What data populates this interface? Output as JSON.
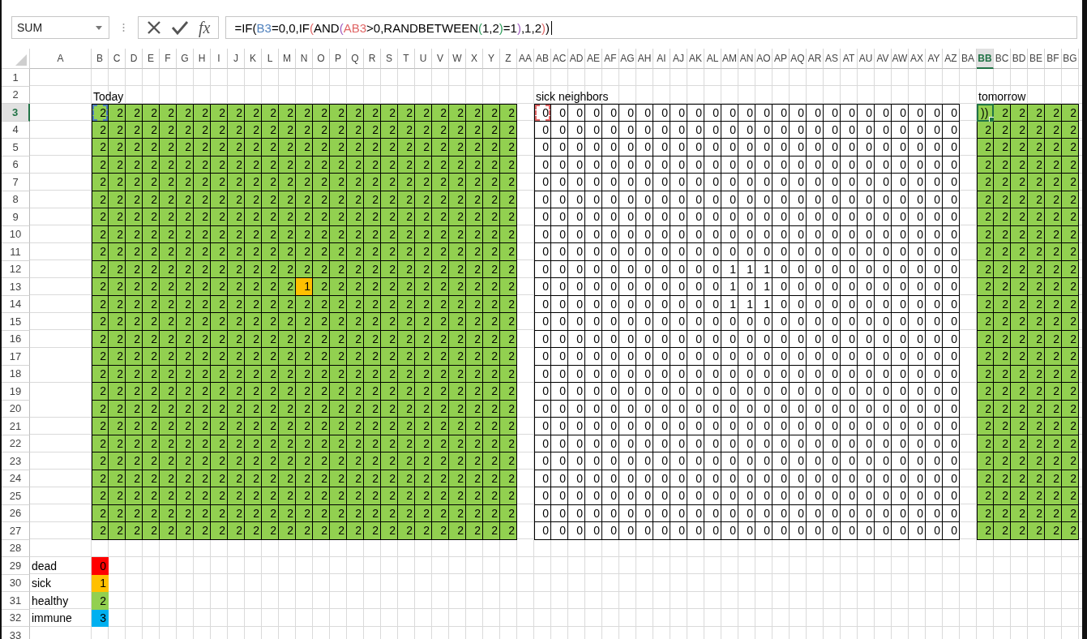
{
  "name_box": {
    "value": "SUM"
  },
  "insert_function": "fx",
  "formula": [
    {
      "text": "=IF(",
      "color": "#000000"
    },
    {
      "text": "B3",
      "color": "#4f81bd"
    },
    {
      "text": "=0,0,IF",
      "color": "#000000"
    },
    {
      "text": "(",
      "color": "#e06666"
    },
    {
      "text": "AND",
      "color": "#000000"
    },
    {
      "text": "(",
      "color": "#a05cc0"
    },
    {
      "text": "AB3",
      "color": "#e06666"
    },
    {
      "text": ">0,RANDBETWEEN",
      "color": "#000000"
    },
    {
      "text": "(",
      "color": "#2e9d5a"
    },
    {
      "text": "1,2",
      "color": "#000000"
    },
    {
      "text": ")",
      "color": "#2e9d5a"
    },
    {
      "text": "=1",
      "color": "#000000"
    },
    {
      "text": ")",
      "color": "#a05cc0"
    },
    {
      "text": ",1,2",
      "color": "#000000"
    },
    {
      "text": ")",
      "color": "#e06666"
    },
    {
      "text": ")",
      "color": "#000000"
    }
  ],
  "sheet": {
    "columns": [
      {
        "label": "A",
        "selected": false
      },
      {
        "label": "B",
        "selected": false
      },
      {
        "label": "C",
        "selected": false
      },
      {
        "label": "D",
        "selected": false
      },
      {
        "label": "E",
        "selected": false
      },
      {
        "label": "F",
        "selected": false
      },
      {
        "label": "G",
        "selected": false
      },
      {
        "label": "H",
        "selected": false
      },
      {
        "label": "I",
        "selected": false
      },
      {
        "label": "J",
        "selected": false
      },
      {
        "label": "K",
        "selected": false
      },
      {
        "label": "L",
        "selected": false
      },
      {
        "label": "M",
        "selected": false
      },
      {
        "label": "N",
        "selected": false
      },
      {
        "label": "O",
        "selected": false
      },
      {
        "label": "P",
        "selected": false
      },
      {
        "label": "Q",
        "selected": false
      },
      {
        "label": "R",
        "selected": false
      },
      {
        "label": "S",
        "selected": false
      },
      {
        "label": "T",
        "selected": false
      },
      {
        "label": "U",
        "selected": false
      },
      {
        "label": "V",
        "selected": false
      },
      {
        "label": "W",
        "selected": false
      },
      {
        "label": "X",
        "selected": false
      },
      {
        "label": "Y",
        "selected": false
      },
      {
        "label": "Z",
        "selected": false
      },
      {
        "label": "AA",
        "selected": false
      },
      {
        "label": "AB",
        "selected": false
      },
      {
        "label": "AC",
        "selected": false
      },
      {
        "label": "AD",
        "selected": false
      },
      {
        "label": "AE",
        "selected": false
      },
      {
        "label": "AF",
        "selected": false
      },
      {
        "label": "AG",
        "selected": false
      },
      {
        "label": "AH",
        "selected": false
      },
      {
        "label": "AI",
        "selected": false
      },
      {
        "label": "AJ",
        "selected": false
      },
      {
        "label": "AK",
        "selected": false
      },
      {
        "label": "AL",
        "selected": false
      },
      {
        "label": "AM",
        "selected": false
      },
      {
        "label": "AN",
        "selected": false
      },
      {
        "label": "AO",
        "selected": false
      },
      {
        "label": "AP",
        "selected": false
      },
      {
        "label": "AQ",
        "selected": false
      },
      {
        "label": "AR",
        "selected": false
      },
      {
        "label": "AS",
        "selected": false
      },
      {
        "label": "AT",
        "selected": false
      },
      {
        "label": "AU",
        "selected": false
      },
      {
        "label": "AV",
        "selected": false
      },
      {
        "label": "AW",
        "selected": false
      },
      {
        "label": "AX",
        "selected": false
      },
      {
        "label": "AY",
        "selected": false
      },
      {
        "label": "AZ",
        "selected": false
      },
      {
        "label": "BA",
        "selected": false
      },
      {
        "label": "BB",
        "selected": true
      },
      {
        "label": "BC",
        "selected": false
      },
      {
        "label": "BD",
        "selected": false
      },
      {
        "label": "BE",
        "selected": false
      },
      {
        "label": "BF",
        "selected": false
      },
      {
        "label": "BG",
        "selected": false
      }
    ],
    "rows": [
      {
        "label": "1",
        "selected": false
      },
      {
        "label": "2",
        "selected": false
      },
      {
        "label": "3",
        "selected": true
      },
      {
        "label": "4",
        "selected": false
      },
      {
        "label": "5",
        "selected": false
      },
      {
        "label": "6",
        "selected": false
      },
      {
        "label": "7",
        "selected": false
      },
      {
        "label": "8",
        "selected": false
      },
      {
        "label": "9",
        "selected": false
      },
      {
        "label": "10",
        "selected": false
      },
      {
        "label": "11",
        "selected": false
      },
      {
        "label": "12",
        "selected": false
      },
      {
        "label": "13",
        "selected": false
      },
      {
        "label": "14",
        "selected": false
      },
      {
        "label": "15",
        "selected": false
      },
      {
        "label": "16",
        "selected": false
      },
      {
        "label": "17",
        "selected": false
      },
      {
        "label": "18",
        "selected": false
      },
      {
        "label": "19",
        "selected": false
      },
      {
        "label": "20",
        "selected": false
      },
      {
        "label": "21",
        "selected": false
      },
      {
        "label": "22",
        "selected": false
      },
      {
        "label": "23",
        "selected": false
      },
      {
        "label": "24",
        "selected": false
      },
      {
        "label": "25",
        "selected": false
      },
      {
        "label": "26",
        "selected": false
      },
      {
        "label": "27",
        "selected": false
      },
      {
        "label": "28",
        "selected": false
      },
      {
        "label": "29",
        "selected": false
      },
      {
        "label": "30",
        "selected": false
      },
      {
        "label": "31",
        "selected": false
      },
      {
        "label": "32",
        "selected": false
      },
      {
        "label": "33",
        "selected": false
      }
    ]
  },
  "today": {
    "title": "Today",
    "kind": "colored",
    "first_cell": {
      "kind": "reference",
      "color": "#4f81bd"
    },
    "rows": [
      [
        "2",
        "2",
        "2",
        "2",
        "2",
        "2",
        "2",
        "2",
        "2",
        "2",
        "2",
        "2",
        "2",
        "2",
        "2",
        "2",
        "2",
        "2",
        "2",
        "2",
        "2",
        "2",
        "2",
        "2",
        "2"
      ],
      [
        "2",
        "2",
        "2",
        "2",
        "2",
        "2",
        "2",
        "2",
        "2",
        "2",
        "2",
        "2",
        "2",
        "2",
        "2",
        "2",
        "2",
        "2",
        "2",
        "2",
        "2",
        "2",
        "2",
        "2",
        "2"
      ],
      [
        "2",
        "2",
        "2",
        "2",
        "2",
        "2",
        "2",
        "2",
        "2",
        "2",
        "2",
        "2",
        "2",
        "2",
        "2",
        "2",
        "2",
        "2",
        "2",
        "2",
        "2",
        "2",
        "2",
        "2",
        "2"
      ],
      [
        "2",
        "2",
        "2",
        "2",
        "2",
        "2",
        "2",
        "2",
        "2",
        "2",
        "2",
        "2",
        "2",
        "2",
        "2",
        "2",
        "2",
        "2",
        "2",
        "2",
        "2",
        "2",
        "2",
        "2",
        "2"
      ],
      [
        "2",
        "2",
        "2",
        "2",
        "2",
        "2",
        "2",
        "2",
        "2",
        "2",
        "2",
        "2",
        "2",
        "2",
        "2",
        "2",
        "2",
        "2",
        "2",
        "2",
        "2",
        "2",
        "2",
        "2",
        "2"
      ],
      [
        "2",
        "2",
        "2",
        "2",
        "2",
        "2",
        "2",
        "2",
        "2",
        "2",
        "2",
        "2",
        "2",
        "2",
        "2",
        "2",
        "2",
        "2",
        "2",
        "2",
        "2",
        "2",
        "2",
        "2",
        "2"
      ],
      [
        "2",
        "2",
        "2",
        "2",
        "2",
        "2",
        "2",
        "2",
        "2",
        "2",
        "2",
        "2",
        "2",
        "2",
        "2",
        "2",
        "2",
        "2",
        "2",
        "2",
        "2",
        "2",
        "2",
        "2",
        "2"
      ],
      [
        "2",
        "2",
        "2",
        "2",
        "2",
        "2",
        "2",
        "2",
        "2",
        "2",
        "2",
        "2",
        "2",
        "2",
        "2",
        "2",
        "2",
        "2",
        "2",
        "2",
        "2",
        "2",
        "2",
        "2",
        "2"
      ],
      [
        "2",
        "2",
        "2",
        "2",
        "2",
        "2",
        "2",
        "2",
        "2",
        "2",
        "2",
        "2",
        "2",
        "2",
        "2",
        "2",
        "2",
        "2",
        "2",
        "2",
        "2",
        "2",
        "2",
        "2",
        "2"
      ],
      [
        "2",
        "2",
        "2",
        "2",
        "2",
        "2",
        "2",
        "2",
        "2",
        "2",
        "2",
        "2",
        "2",
        "2",
        "2",
        "2",
        "2",
        "2",
        "2",
        "2",
        "2",
        "2",
        "2",
        "2",
        "2"
      ],
      [
        "2",
        "2",
        "2",
        "2",
        "2",
        "2",
        "2",
        "2",
        "2",
        "2",
        "2",
        "2",
        "1",
        "2",
        "2",
        "2",
        "2",
        "2",
        "2",
        "2",
        "2",
        "2",
        "2",
        "2",
        "2"
      ],
      [
        "2",
        "2",
        "2",
        "2",
        "2",
        "2",
        "2",
        "2",
        "2",
        "2",
        "2",
        "2",
        "2",
        "2",
        "2",
        "2",
        "2",
        "2",
        "2",
        "2",
        "2",
        "2",
        "2",
        "2",
        "2"
      ],
      [
        "2",
        "2",
        "2",
        "2",
        "2",
        "2",
        "2",
        "2",
        "2",
        "2",
        "2",
        "2",
        "2",
        "2",
        "2",
        "2",
        "2",
        "2",
        "2",
        "2",
        "2",
        "2",
        "2",
        "2",
        "2"
      ],
      [
        "2",
        "2",
        "2",
        "2",
        "2",
        "2",
        "2",
        "2",
        "2",
        "2",
        "2",
        "2",
        "2",
        "2",
        "2",
        "2",
        "2",
        "2",
        "2",
        "2",
        "2",
        "2",
        "2",
        "2",
        "2"
      ],
      [
        "2",
        "2",
        "2",
        "2",
        "2",
        "2",
        "2",
        "2",
        "2",
        "2",
        "2",
        "2",
        "2",
        "2",
        "2",
        "2",
        "2",
        "2",
        "2",
        "2",
        "2",
        "2",
        "2",
        "2",
        "2"
      ],
      [
        "2",
        "2",
        "2",
        "2",
        "2",
        "2",
        "2",
        "2",
        "2",
        "2",
        "2",
        "2",
        "2",
        "2",
        "2",
        "2",
        "2",
        "2",
        "2",
        "2",
        "2",
        "2",
        "2",
        "2",
        "2"
      ],
      [
        "2",
        "2",
        "2",
        "2",
        "2",
        "2",
        "2",
        "2",
        "2",
        "2",
        "2",
        "2",
        "2",
        "2",
        "2",
        "2",
        "2",
        "2",
        "2",
        "2",
        "2",
        "2",
        "2",
        "2",
        "2"
      ],
      [
        "2",
        "2",
        "2",
        "2",
        "2",
        "2",
        "2",
        "2",
        "2",
        "2",
        "2",
        "2",
        "2",
        "2",
        "2",
        "2",
        "2",
        "2",
        "2",
        "2",
        "2",
        "2",
        "2",
        "2",
        "2"
      ],
      [
        "2",
        "2",
        "2",
        "2",
        "2",
        "2",
        "2",
        "2",
        "2",
        "2",
        "2",
        "2",
        "2",
        "2",
        "2",
        "2",
        "2",
        "2",
        "2",
        "2",
        "2",
        "2",
        "2",
        "2",
        "2"
      ],
      [
        "2",
        "2",
        "2",
        "2",
        "2",
        "2",
        "2",
        "2",
        "2",
        "2",
        "2",
        "2",
        "2",
        "2",
        "2",
        "2",
        "2",
        "2",
        "2",
        "2",
        "2",
        "2",
        "2",
        "2",
        "2"
      ],
      [
        "2",
        "2",
        "2",
        "2",
        "2",
        "2",
        "2",
        "2",
        "2",
        "2",
        "2",
        "2",
        "2",
        "2",
        "2",
        "2",
        "2",
        "2",
        "2",
        "2",
        "2",
        "2",
        "2",
        "2",
        "2"
      ],
      [
        "2",
        "2",
        "2",
        "2",
        "2",
        "2",
        "2",
        "2",
        "2",
        "2",
        "2",
        "2",
        "2",
        "2",
        "2",
        "2",
        "2",
        "2",
        "2",
        "2",
        "2",
        "2",
        "2",
        "2",
        "2"
      ],
      [
        "2",
        "2",
        "2",
        "2",
        "2",
        "2",
        "2",
        "2",
        "2",
        "2",
        "2",
        "2",
        "2",
        "2",
        "2",
        "2",
        "2",
        "2",
        "2",
        "2",
        "2",
        "2",
        "2",
        "2",
        "2"
      ],
      [
        "2",
        "2",
        "2",
        "2",
        "2",
        "2",
        "2",
        "2",
        "2",
        "2",
        "2",
        "2",
        "2",
        "2",
        "2",
        "2",
        "2",
        "2",
        "2",
        "2",
        "2",
        "2",
        "2",
        "2",
        "2"
      ],
      [
        "2",
        "2",
        "2",
        "2",
        "2",
        "2",
        "2",
        "2",
        "2",
        "2",
        "2",
        "2",
        "2",
        "2",
        "2",
        "2",
        "2",
        "2",
        "2",
        "2",
        "2",
        "2",
        "2",
        "2",
        "2"
      ]
    ]
  },
  "sick_neighbors": {
    "title": "sick neighbors",
    "kind": "plain",
    "first_cell": {
      "kind": "reference",
      "color": "#e06666"
    },
    "rows": [
      [
        "0",
        "0",
        "0",
        "0",
        "0",
        "0",
        "0",
        "0",
        "0",
        "0",
        "0",
        "0",
        "0",
        "0",
        "0",
        "0",
        "0",
        "0",
        "0",
        "0",
        "0",
        "0",
        "0",
        "0",
        "0"
      ],
      [
        "0",
        "0",
        "0",
        "0",
        "0",
        "0",
        "0",
        "0",
        "0",
        "0",
        "0",
        "0",
        "0",
        "0",
        "0",
        "0",
        "0",
        "0",
        "0",
        "0",
        "0",
        "0",
        "0",
        "0",
        "0"
      ],
      [
        "0",
        "0",
        "0",
        "0",
        "0",
        "0",
        "0",
        "0",
        "0",
        "0",
        "0",
        "0",
        "0",
        "0",
        "0",
        "0",
        "0",
        "0",
        "0",
        "0",
        "0",
        "0",
        "0",
        "0",
        "0"
      ],
      [
        "0",
        "0",
        "0",
        "0",
        "0",
        "0",
        "0",
        "0",
        "0",
        "0",
        "0",
        "0",
        "0",
        "0",
        "0",
        "0",
        "0",
        "0",
        "0",
        "0",
        "0",
        "0",
        "0",
        "0",
        "0"
      ],
      [
        "0",
        "0",
        "0",
        "0",
        "0",
        "0",
        "0",
        "0",
        "0",
        "0",
        "0",
        "0",
        "0",
        "0",
        "0",
        "0",
        "0",
        "0",
        "0",
        "0",
        "0",
        "0",
        "0",
        "0",
        "0"
      ],
      [
        "0",
        "0",
        "0",
        "0",
        "0",
        "0",
        "0",
        "0",
        "0",
        "0",
        "0",
        "0",
        "0",
        "0",
        "0",
        "0",
        "0",
        "0",
        "0",
        "0",
        "0",
        "0",
        "0",
        "0",
        "0"
      ],
      [
        "0",
        "0",
        "0",
        "0",
        "0",
        "0",
        "0",
        "0",
        "0",
        "0",
        "0",
        "0",
        "0",
        "0",
        "0",
        "0",
        "0",
        "0",
        "0",
        "0",
        "0",
        "0",
        "0",
        "0",
        "0"
      ],
      [
        "0",
        "0",
        "0",
        "0",
        "0",
        "0",
        "0",
        "0",
        "0",
        "0",
        "0",
        "0",
        "0",
        "0",
        "0",
        "0",
        "0",
        "0",
        "0",
        "0",
        "0",
        "0",
        "0",
        "0",
        "0"
      ],
      [
        "0",
        "0",
        "0",
        "0",
        "0",
        "0",
        "0",
        "0",
        "0",
        "0",
        "0",
        "0",
        "0",
        "0",
        "0",
        "0",
        "0",
        "0",
        "0",
        "0",
        "0",
        "0",
        "0",
        "0",
        "0"
      ],
      [
        "0",
        "0",
        "0",
        "0",
        "0",
        "0",
        "0",
        "0",
        "0",
        "0",
        "0",
        "1",
        "1",
        "1",
        "0",
        "0",
        "0",
        "0",
        "0",
        "0",
        "0",
        "0",
        "0",
        "0",
        "0"
      ],
      [
        "0",
        "0",
        "0",
        "0",
        "0",
        "0",
        "0",
        "0",
        "0",
        "0",
        "0",
        "1",
        "0",
        "1",
        "0",
        "0",
        "0",
        "0",
        "0",
        "0",
        "0",
        "0",
        "0",
        "0",
        "0"
      ],
      [
        "0",
        "0",
        "0",
        "0",
        "0",
        "0",
        "0",
        "0",
        "0",
        "0",
        "0",
        "1",
        "1",
        "1",
        "0",
        "0",
        "0",
        "0",
        "0",
        "0",
        "0",
        "0",
        "0",
        "0",
        "0"
      ],
      [
        "0",
        "0",
        "0",
        "0",
        "0",
        "0",
        "0",
        "0",
        "0",
        "0",
        "0",
        "0",
        "0",
        "0",
        "0",
        "0",
        "0",
        "0",
        "0",
        "0",
        "0",
        "0",
        "0",
        "0",
        "0"
      ],
      [
        "0",
        "0",
        "0",
        "0",
        "0",
        "0",
        "0",
        "0",
        "0",
        "0",
        "0",
        "0",
        "0",
        "0",
        "0",
        "0",
        "0",
        "0",
        "0",
        "0",
        "0",
        "0",
        "0",
        "0",
        "0"
      ],
      [
        "0",
        "0",
        "0",
        "0",
        "0",
        "0",
        "0",
        "0",
        "0",
        "0",
        "0",
        "0",
        "0",
        "0",
        "0",
        "0",
        "0",
        "0",
        "0",
        "0",
        "0",
        "0",
        "0",
        "0",
        "0"
      ],
      [
        "0",
        "0",
        "0",
        "0",
        "0",
        "0",
        "0",
        "0",
        "0",
        "0",
        "0",
        "0",
        "0",
        "0",
        "0",
        "0",
        "0",
        "0",
        "0",
        "0",
        "0",
        "0",
        "0",
        "0",
        "0"
      ],
      [
        "0",
        "0",
        "0",
        "0",
        "0",
        "0",
        "0",
        "0",
        "0",
        "0",
        "0",
        "0",
        "0",
        "0",
        "0",
        "0",
        "0",
        "0",
        "0",
        "0",
        "0",
        "0",
        "0",
        "0",
        "0"
      ],
      [
        "0",
        "0",
        "0",
        "0",
        "0",
        "0",
        "0",
        "0",
        "0",
        "0",
        "0",
        "0",
        "0",
        "0",
        "0",
        "0",
        "0",
        "0",
        "0",
        "0",
        "0",
        "0",
        "0",
        "0",
        "0"
      ],
      [
        "0",
        "0",
        "0",
        "0",
        "0",
        "0",
        "0",
        "0",
        "0",
        "0",
        "0",
        "0",
        "0",
        "0",
        "0",
        "0",
        "0",
        "0",
        "0",
        "0",
        "0",
        "0",
        "0",
        "0",
        "0"
      ],
      [
        "0",
        "0",
        "0",
        "0",
        "0",
        "0",
        "0",
        "0",
        "0",
        "0",
        "0",
        "0",
        "0",
        "0",
        "0",
        "0",
        "0",
        "0",
        "0",
        "0",
        "0",
        "0",
        "0",
        "0",
        "0"
      ],
      [
        "0",
        "0",
        "0",
        "0",
        "0",
        "0",
        "0",
        "0",
        "0",
        "0",
        "0",
        "0",
        "0",
        "0",
        "0",
        "0",
        "0",
        "0",
        "0",
        "0",
        "0",
        "0",
        "0",
        "0",
        "0"
      ],
      [
        "0",
        "0",
        "0",
        "0",
        "0",
        "0",
        "0",
        "0",
        "0",
        "0",
        "0",
        "0",
        "0",
        "0",
        "0",
        "0",
        "0",
        "0",
        "0",
        "0",
        "0",
        "0",
        "0",
        "0",
        "0"
      ],
      [
        "0",
        "0",
        "0",
        "0",
        "0",
        "0",
        "0",
        "0",
        "0",
        "0",
        "0",
        "0",
        "0",
        "0",
        "0",
        "0",
        "0",
        "0",
        "0",
        "0",
        "0",
        "0",
        "0",
        "0",
        "0"
      ],
      [
        "0",
        "0",
        "0",
        "0",
        "0",
        "0",
        "0",
        "0",
        "0",
        "0",
        "0",
        "0",
        "0",
        "0",
        "0",
        "0",
        "0",
        "0",
        "0",
        "0",
        "0",
        "0",
        "0",
        "0",
        "0"
      ],
      [
        "0",
        "0",
        "0",
        "0",
        "0",
        "0",
        "0",
        "0",
        "0",
        "0",
        "0",
        "0",
        "0",
        "0",
        "0",
        "0",
        "0",
        "0",
        "0",
        "0",
        "0",
        "0",
        "0",
        "0",
        "0"
      ]
    ]
  },
  "tomorrow": {
    "title": "tomorrow",
    "kind": "colored",
    "first_cell": {
      "kind": "active",
      "color": "#217346"
    },
    "rows": [
      [
        "))",
        "2",
        "2",
        "2",
        "2",
        "2"
      ],
      [
        "2",
        "2",
        "2",
        "2",
        "2",
        "2"
      ],
      [
        "2",
        "2",
        "2",
        "2",
        "2",
        "2"
      ],
      [
        "2",
        "2",
        "2",
        "2",
        "2",
        "2"
      ],
      [
        "2",
        "2",
        "2",
        "2",
        "2",
        "2"
      ],
      [
        "2",
        "2",
        "2",
        "2",
        "2",
        "2"
      ],
      [
        "2",
        "2",
        "2",
        "2",
        "2",
        "2"
      ],
      [
        "2",
        "2",
        "2",
        "2",
        "2",
        "2"
      ],
      [
        "2",
        "2",
        "2",
        "2",
        "2",
        "2"
      ],
      [
        "2",
        "2",
        "2",
        "2",
        "2",
        "2"
      ],
      [
        "2",
        "2",
        "2",
        "2",
        "2",
        "2"
      ],
      [
        "2",
        "2",
        "2",
        "2",
        "2",
        "2"
      ],
      [
        "2",
        "2",
        "2",
        "2",
        "2",
        "2"
      ],
      [
        "2",
        "2",
        "2",
        "2",
        "2",
        "2"
      ],
      [
        "2",
        "2",
        "2",
        "2",
        "2",
        "2"
      ],
      [
        "2",
        "2",
        "2",
        "2",
        "2",
        "2"
      ],
      [
        "2",
        "2",
        "2",
        "2",
        "2",
        "2"
      ],
      [
        "2",
        "2",
        "2",
        "2",
        "2",
        "2"
      ],
      [
        "2",
        "2",
        "2",
        "2",
        "2",
        "2"
      ],
      [
        "2",
        "2",
        "2",
        "2",
        "2",
        "2"
      ],
      [
        "2",
        "2",
        "2",
        "2",
        "2",
        "2"
      ],
      [
        "2",
        "2",
        "2",
        "2",
        "2",
        "2"
      ],
      [
        "2",
        "2",
        "2",
        "2",
        "2",
        "2"
      ],
      [
        "2",
        "2",
        "2",
        "2",
        "2",
        "2"
      ],
      [
        "2",
        "2",
        "2",
        "2",
        "2",
        "2"
      ]
    ]
  },
  "legend": [
    {
      "label": "dead",
      "value": "0",
      "color": "#ff0000"
    },
    {
      "label": "sick",
      "value": "1",
      "color": "#ffc000"
    },
    {
      "label": "healthy",
      "value": "2",
      "color": "#92d050"
    },
    {
      "label": "immune",
      "value": "3",
      "color": "#00b0f0"
    }
  ]
}
